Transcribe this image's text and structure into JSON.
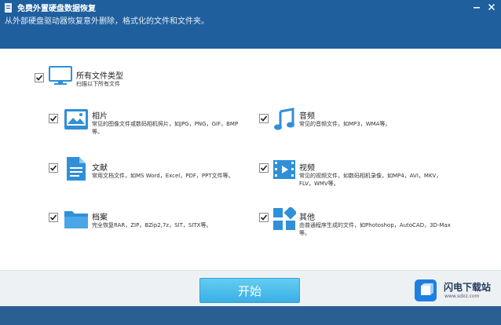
{
  "header": {
    "title": "免费外置硬盘数据恢复",
    "subtitle": "从外部硬盘驱动器恢复意外删除，格式化的文件和文件夹。",
    "app_icon": "app-icon",
    "minimize_icon": "minimize-icon",
    "close_icon": "close-icon"
  },
  "all_types": {
    "title": "所有文件类型",
    "desc": "扫描以下所有文件",
    "icon": "monitor-icon",
    "checked": true
  },
  "types": [
    {
      "title": "相片",
      "desc": "常见的图像文件或数码相机照片，如JPG，PNG，GIF，BMP等。",
      "icon": "photo-icon",
      "checked": true
    },
    {
      "title": "音频",
      "desc": "常见的音频文件，如MP3，WMA等。",
      "icon": "music-note-icon",
      "checked": true
    },
    {
      "title": "文献",
      "desc": "常用文档文件，如MS Word，Excel，PDF，PPT文件等。",
      "icon": "document-icon",
      "checked": true
    },
    {
      "title": "视频",
      "desc": "常见的视频文件，如数码相机录像，如MP4，AVI，MKV，FLV，WMV等。",
      "icon": "film-icon",
      "checked": true
    },
    {
      "title": "档案",
      "desc": "完全恢复RAR，ZIP，BZip2,7z，SIT，SITX等。",
      "icon": "folder-icon",
      "checked": true
    },
    {
      "title": "其他",
      "desc": "由普通程序生成的文件，如Photoshop，AutoCAD，3D-Max等。",
      "icon": "grid-icon",
      "checked": true
    }
  ],
  "footer": {
    "start_label": "开始"
  },
  "watermark": {
    "name": "闪电下载站",
    "url": "www.sdxz.com"
  },
  "colors": {
    "header_bg": "#1f5f9e",
    "accent": "#3aaee6",
    "icon_blue": "#2f8fd8"
  }
}
